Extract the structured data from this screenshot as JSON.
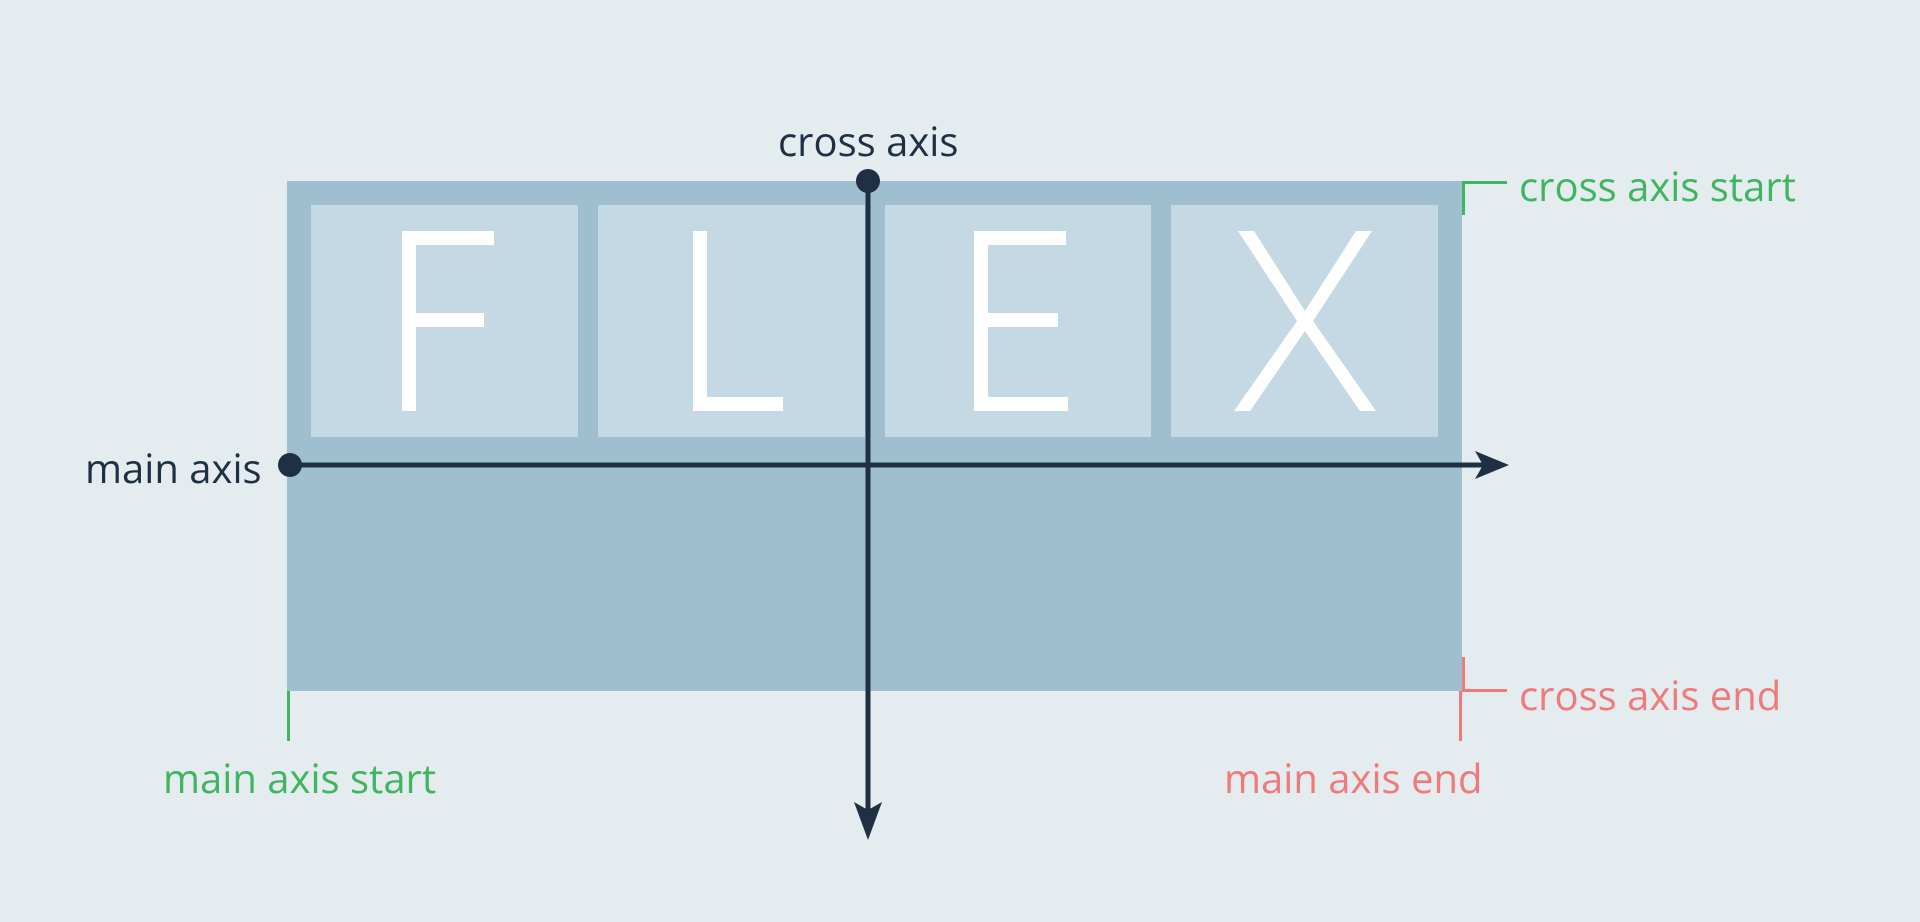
{
  "labels": {
    "cross_axis": "cross axis",
    "main_axis": "main axis",
    "cross_axis_start": "cross axis start",
    "cross_axis_end": "cross axis end",
    "main_axis_start": "main axis start",
    "main_axis_end": "main axis end"
  },
  "letters": {
    "f": "F",
    "l": "L",
    "e": "E",
    "x": "X"
  },
  "colors": {
    "background": "#e4ecef",
    "container": "#9fbfd1",
    "item": "#c4d9e3",
    "letter": "#ffffff",
    "axis": "#1f3044",
    "start": "#3fb55f",
    "end": "#f07a7a"
  }
}
